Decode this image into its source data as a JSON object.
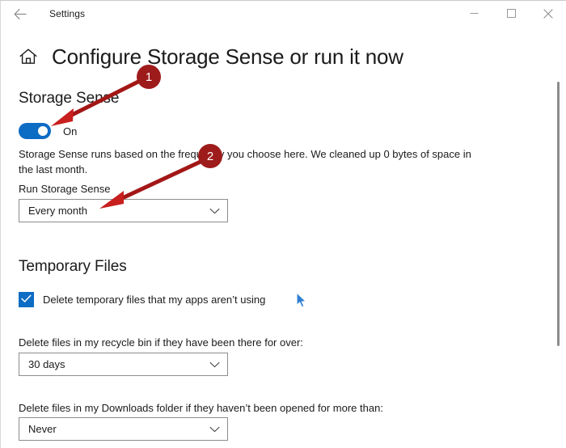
{
  "window": {
    "title": "Settings",
    "back_icon": "back-arrow-icon",
    "minimize_label": "Minimize",
    "maximize_label": "Maximize",
    "close_label": "Close"
  },
  "header": {
    "home_icon": "home-icon",
    "title": "Configure Storage Sense or run it now"
  },
  "storage_sense": {
    "heading": "Storage Sense",
    "toggle_state": "On",
    "toggle_on": true,
    "description": "Storage Sense runs based on the frequency you choose here. We cleaned up 0 bytes of space in the last month.",
    "run_label": "Run Storage Sense",
    "run_value": "Every month"
  },
  "temporary_files": {
    "heading": "Temporary Files",
    "checkbox_label": "Delete temporary files that my apps aren’t using",
    "checkbox_checked": true,
    "recycle_bin_label": "Delete files in my recycle bin if they have been there for over:",
    "recycle_bin_value": "30 days",
    "downloads_label": "Delete files in my Downloads folder if they haven’t been opened for more than:",
    "downloads_value": "Never"
  },
  "annotations": {
    "badges": [
      {
        "label": "1"
      },
      {
        "label": "2"
      }
    ],
    "color": "#9e1b1b"
  },
  "colors": {
    "accent": "#0d6cc4",
    "text": "#1b1b1b",
    "border": "#8d8d8d",
    "annotation": "#9e1b1b"
  }
}
